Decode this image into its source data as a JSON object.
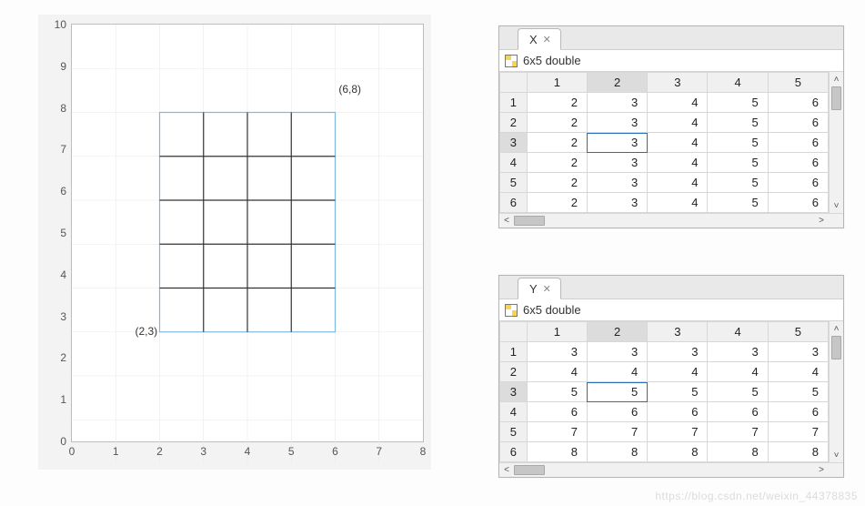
{
  "watermark": "https://blog.csdn.net/weixin_44378835",
  "chart_data": {
    "type": "line",
    "title": "",
    "xlabel": "",
    "ylabel": "",
    "xlim": [
      0,
      8
    ],
    "ylim": [
      0,
      10
    ],
    "xticks": [
      0,
      1,
      2,
      3,
      4,
      5,
      6,
      7,
      8
    ],
    "yticks": [
      0,
      1,
      2,
      3,
      4,
      5,
      6,
      7,
      8,
      9,
      10
    ],
    "grid": {
      "x_lines": [
        2,
        3,
        4,
        5,
        6
      ],
      "y_lines": [
        3,
        4,
        5,
        6,
        7,
        8
      ],
      "extent": {
        "xmin": 2,
        "xmax": 6,
        "ymin": 3,
        "ymax": 8
      }
    },
    "annotations": [
      {
        "text": "(6,8)",
        "x": 6,
        "y": 8,
        "pos": "above-right"
      },
      {
        "text": "(2,3)",
        "x": 2,
        "y": 3,
        "pos": "below-left"
      }
    ]
  },
  "variables": {
    "X": {
      "tab_label": "X",
      "desc": "6x5 double",
      "col_headers": [
        "1",
        "2",
        "3",
        "4",
        "5"
      ],
      "row_headers": [
        "1",
        "2",
        "3",
        "4",
        "5",
        "6"
      ],
      "selected_col": 2,
      "selected_row": 3,
      "data": [
        [
          2,
          3,
          4,
          5,
          6
        ],
        [
          2,
          3,
          4,
          5,
          6
        ],
        [
          2,
          3,
          4,
          5,
          6
        ],
        [
          2,
          3,
          4,
          5,
          6
        ],
        [
          2,
          3,
          4,
          5,
          6
        ],
        [
          2,
          3,
          4,
          5,
          6
        ]
      ]
    },
    "Y": {
      "tab_label": "Y",
      "desc": "6x5 double",
      "col_headers": [
        "1",
        "2",
        "3",
        "4",
        "5"
      ],
      "row_headers": [
        "1",
        "2",
        "3",
        "4",
        "5",
        "6"
      ],
      "selected_col": 2,
      "selected_row": 3,
      "data": [
        [
          3,
          3,
          3,
          3,
          3
        ],
        [
          4,
          4,
          4,
          4,
          4
        ],
        [
          5,
          5,
          5,
          5,
          5
        ],
        [
          6,
          6,
          6,
          6,
          6
        ],
        [
          7,
          7,
          7,
          7,
          7
        ],
        [
          8,
          8,
          8,
          8,
          8
        ]
      ]
    }
  }
}
